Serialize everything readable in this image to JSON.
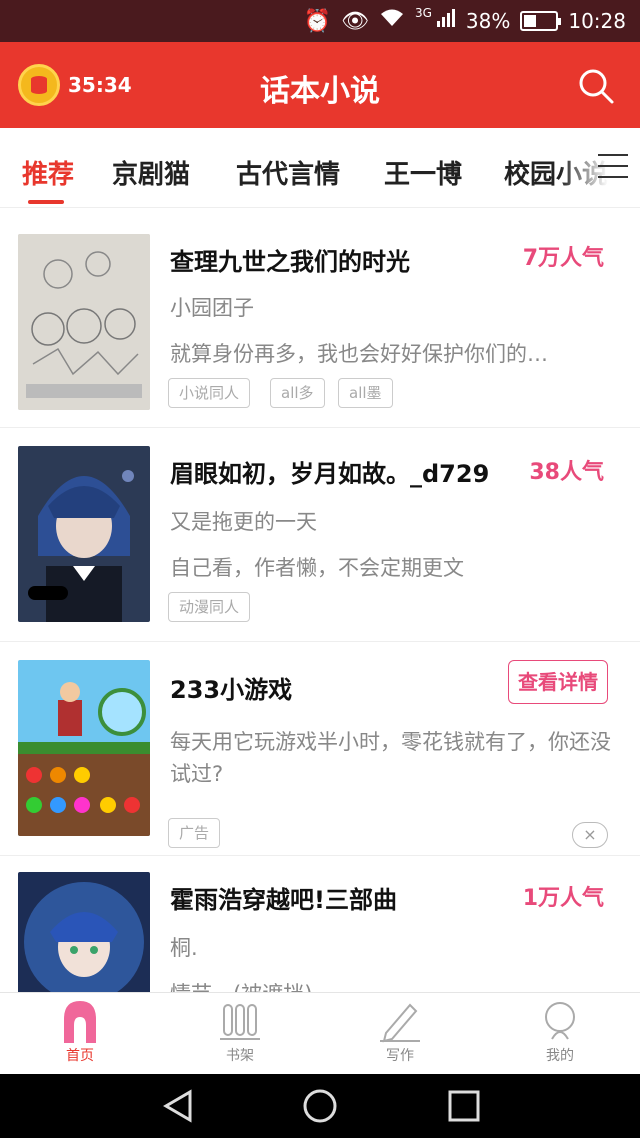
{
  "status_bar": {
    "signal_label": "3G",
    "battery_percent": 38,
    "battery_label": "38%",
    "time": "10:28"
  },
  "header": {
    "timer": "35:34",
    "title": "话本小说",
    "search_icon": "search-icon",
    "accent": "#e8372d"
  },
  "tabs": [
    {
      "label": "推荐",
      "active": true
    },
    {
      "label": "京剧猫",
      "active": false
    },
    {
      "label": "古代言情",
      "active": false
    },
    {
      "label": "王一博",
      "active": false
    },
    {
      "label": "校园小说",
      "active": false
    }
  ],
  "books": [
    {
      "title": "查理九世之我们的时光",
      "popularity": "7万人气",
      "author": "小园团子",
      "desc": "就算身份再多，我也会好好保护你们的…",
      "tags": [
        "小说同人",
        "all多",
        "all墨"
      ]
    },
    {
      "title": "眉眼如初，岁月如故。_d729",
      "popularity": "38人气",
      "author": "又是拖更的一天",
      "desc": "自己看，作者懒，不会定期更文",
      "tags": [
        "动漫同人"
      ]
    },
    {
      "title": "233小游戏",
      "action": "查看详情",
      "desc": "每天用它玩游戏半小时，零花钱就有了，你还没试过?",
      "tags": [
        "广告"
      ],
      "close": "×"
    },
    {
      "title": "霍雨浩穿越吧!三部曲",
      "popularity": "1万人气",
      "author": "桐.",
      "desc": "情节…(被遮挡)"
    }
  ],
  "bottom_nav": [
    {
      "label": "首页",
      "icon": "home-icon",
      "active": true
    },
    {
      "label": "书架",
      "icon": "bookshelf-icon",
      "active": false
    },
    {
      "label": "写作",
      "icon": "pen-icon",
      "active": false
    },
    {
      "label": "我的",
      "icon": "profile-icon",
      "active": false
    }
  ]
}
